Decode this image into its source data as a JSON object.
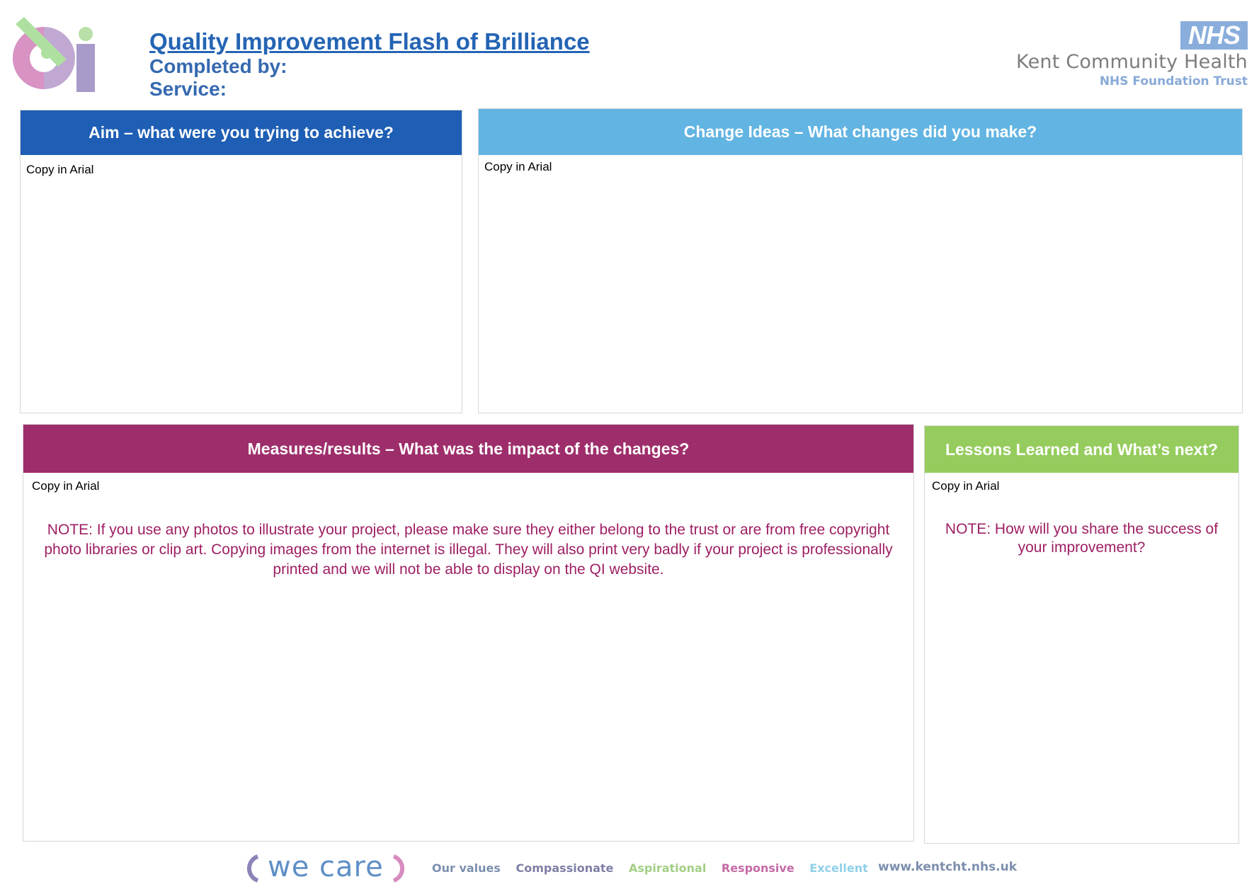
{
  "header": {
    "title": "Quality Improvement Flash of Brilliance",
    "completed_by": "Completed by:",
    "service": "Service:",
    "qi_logo_letters": "QI"
  },
  "nhs": {
    "badge": "NHS",
    "organisation": "Kent Community Health",
    "trust": "NHS Foundation Trust"
  },
  "panels": {
    "aim": {
      "heading": "Aim – what were you trying to achieve?",
      "copy": "Copy in Arial",
      "color": "#1e5eb4"
    },
    "change": {
      "heading": "Change Ideas – What changes did you make?",
      "copy": "Copy in Arial",
      "color": "#62b4e2"
    },
    "measures": {
      "heading": "Measures/results – What was the impact of the changes?",
      "copy": "Copy in Arial",
      "note": "NOTE: If you use any photos to illustrate your project, please make sure they either belong to the trust or are from free copyright photo libraries or clip art. Copying images from the internet is illegal.  They will also print very badly if your project is professionally printed and we will not be able to display on the QI website.",
      "color": "#9e2e6b"
    },
    "lessons": {
      "heading": "Lessons Learned and What’s next?",
      "copy": "Copy in Arial",
      "note": "NOTE: How will you share the success of your improvement?",
      "color": "#95cc5d"
    }
  },
  "footer": {
    "we_care": "we care",
    "values": [
      {
        "label": "Our values",
        "color": "#7c8fae"
      },
      {
        "label": "Compassionate",
        "color": "#7d7fa6"
      },
      {
        "label": "Aspirational",
        "color": "#a3cf85"
      },
      {
        "label": "Responsive",
        "color": "#c46ba6"
      },
      {
        "label": "Excellent",
        "color": "#8fd0e8"
      }
    ],
    "url": "www.kentcht.nhs.uk"
  }
}
